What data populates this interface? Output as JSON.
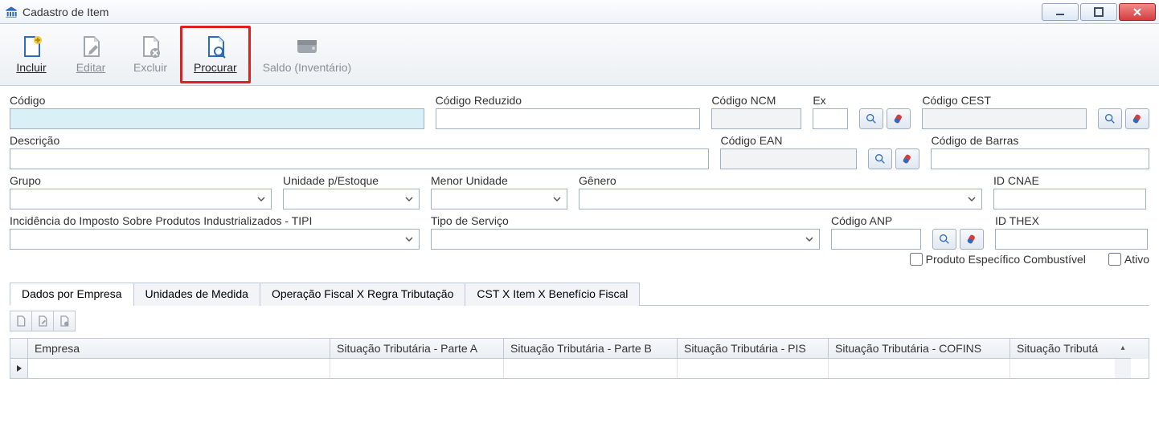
{
  "window": {
    "title": "Cadastro de Item"
  },
  "toolbar": {
    "incluir": "Incluir",
    "editar": "Editar",
    "excluir": "Excluir",
    "procurar": "Procurar",
    "saldo": "Saldo (Inventário)"
  },
  "labels": {
    "codigo": "Código",
    "codigo_reduzido": "Código Reduzido",
    "codigo_ncm": "Código NCM",
    "ex": "Ex",
    "codigo_cest": "Código CEST",
    "descricao": "Descrição",
    "codigo_ean": "Código EAN",
    "codigo_barras": "Código de Barras",
    "grupo": "Grupo",
    "unidade_estoque": "Unidade p/Estoque",
    "menor_unidade": "Menor Unidade",
    "genero": "Gênero",
    "id_cnae": "ID CNAE",
    "tipi": "Incidência do Imposto Sobre Produtos Industrializados - TIPI",
    "tipo_servico": "Tipo de Serviço",
    "codigo_anp": "Código ANP",
    "id_thex": "ID THEX",
    "produto_combustivel": "Produto Específico Combustível",
    "ativo": "Ativo"
  },
  "values": {
    "codigo": "",
    "codigo_reduzido": "",
    "codigo_ncm": "",
    "ex": "",
    "codigo_cest": "",
    "descricao": "",
    "codigo_ean": "",
    "codigo_barras": "",
    "grupo": "",
    "unidade_estoque": "",
    "menor_unidade": "",
    "genero": "",
    "id_cnae": "",
    "tipi": "",
    "tipo_servico": "",
    "codigo_anp": "",
    "id_thex": ""
  },
  "tabs": {
    "dados_empresa": "Dados por Empresa",
    "unidades": "Unidades de Medida",
    "operacao": "Operação Fiscal X Regra Tributação",
    "cst": "CST X Item X Benefício Fiscal"
  },
  "grid": {
    "columns": {
      "empresa": "Empresa",
      "sit_a": "Situação Tributária - Parte A",
      "sit_b": "Situação Tributária - Parte B",
      "sit_pis": "Situação Tributária - PIS",
      "sit_cofins": "Situação Tributária - COFINS",
      "sit_trunc": "Situação Tributá"
    },
    "rows": [
      {
        "empresa": "",
        "sit_a": "",
        "sit_b": "",
        "sit_pis": "",
        "sit_cofins": "",
        "sit_trunc": ""
      }
    ]
  }
}
